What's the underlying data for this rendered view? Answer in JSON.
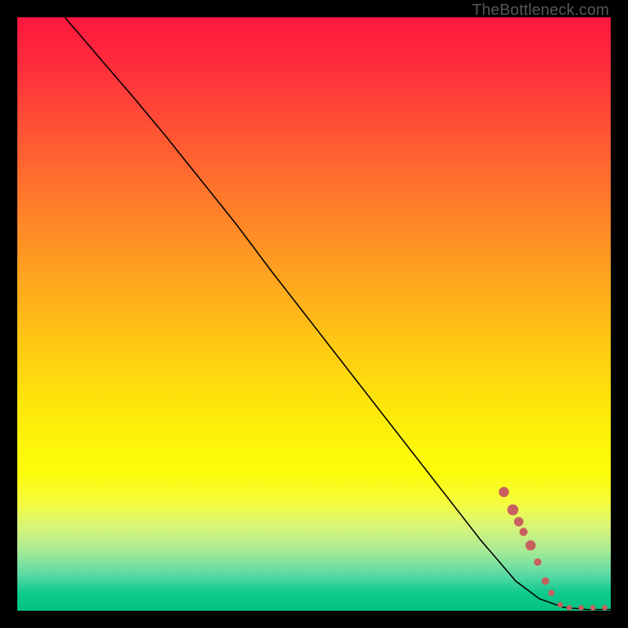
{
  "attribution": "TheBottleneck.com",
  "chart_data": {
    "type": "line",
    "title": "",
    "xlabel": "",
    "ylabel": "",
    "xlim": [
      0,
      100
    ],
    "ylim": [
      0,
      100
    ],
    "grid": false,
    "legend": false,
    "series": [
      {
        "name": "curve",
        "x": [
          8,
          14,
          20,
          25,
          29,
          33,
          37,
          43,
          50,
          57,
          64,
          71,
          78,
          84,
          88,
          92,
          96,
          100
        ],
        "y": [
          100,
          93,
          86,
          80,
          75,
          70,
          65,
          57,
          48,
          39,
          30,
          21,
          12,
          5,
          2,
          0.6,
          0.2,
          0.2
        ]
      }
    ],
    "scatter": [
      {
        "x": 82.0,
        "y": 20.0,
        "r": 6.5
      },
      {
        "x": 83.5,
        "y": 17.0,
        "r": 7.0
      },
      {
        "x": 84.5,
        "y": 15.0,
        "r": 6.0
      },
      {
        "x": 85.3,
        "y": 13.3,
        "r": 5.2
      },
      {
        "x": 86.5,
        "y": 11.0,
        "r": 6.5
      },
      {
        "x": 87.7,
        "y": 8.2,
        "r": 4.8
      },
      {
        "x": 89.0,
        "y": 5.0,
        "r": 4.8
      },
      {
        "x": 90.0,
        "y": 3.0,
        "r": 4.0
      },
      {
        "x": 91.5,
        "y": 1.0,
        "r": 3.5
      },
      {
        "x": 93.0,
        "y": 0.5,
        "r": 3.5
      },
      {
        "x": 95.0,
        "y": 0.5,
        "r": 3.5
      },
      {
        "x": 97.0,
        "y": 0.5,
        "r": 3.5
      },
      {
        "x": 99.0,
        "y": 0.5,
        "r": 3.5
      }
    ],
    "colors": {
      "curve": "#000000",
      "scatter": "#c86060",
      "gradient_top": "#ff163e",
      "gradient_bottom": "#03c37e"
    }
  }
}
